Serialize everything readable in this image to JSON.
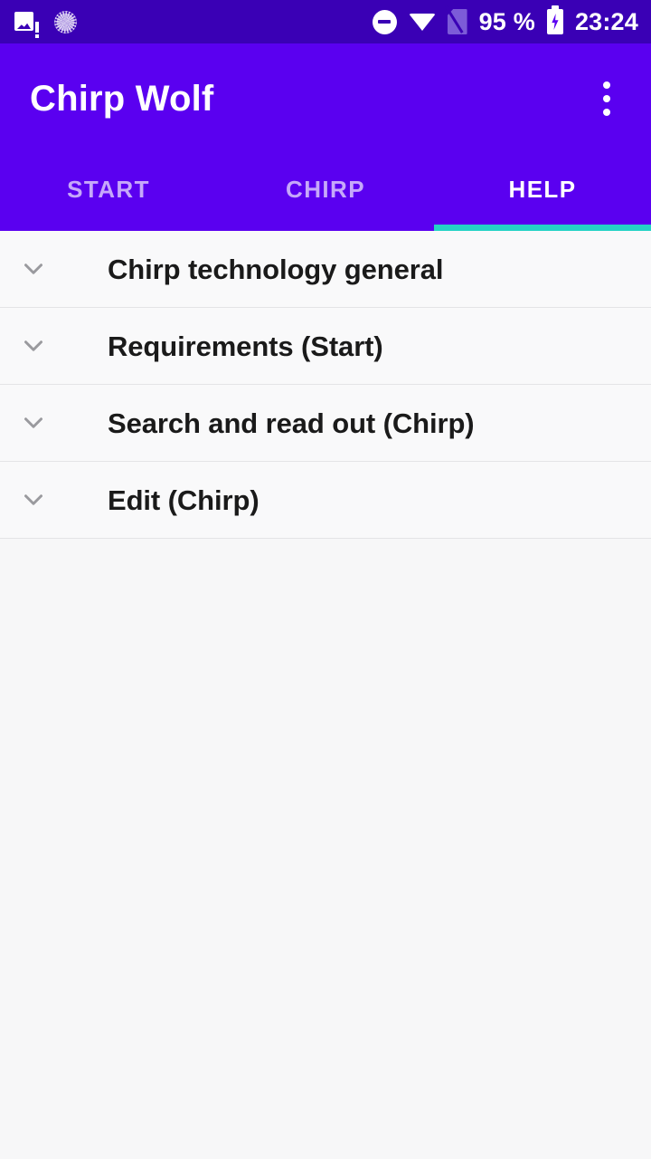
{
  "status_bar": {
    "icons_left": [
      {
        "name": "broken-image-icon",
        "label": "image notification"
      },
      {
        "name": "sync-progress-icon",
        "label": "sync in progress"
      }
    ],
    "icons_right": [
      {
        "name": "do-not-disturb-icon",
        "label": "do not disturb"
      },
      {
        "name": "wifi-icon",
        "label": "wifi connected"
      },
      {
        "name": "no-sim-icon",
        "label": "no sim card"
      }
    ],
    "battery_percent": "95 %",
    "battery_icon": "battery-charging-icon",
    "time": "23:24",
    "background_color": "#3A00B5",
    "foreground_color": "#FFFFFF"
  },
  "app_bar": {
    "title": "Chirp Wolf",
    "overflow_icon": "overflow-menu-icon",
    "background_color": "#5A00F0",
    "title_color": "#FFFFFF"
  },
  "tabs": {
    "items": [
      {
        "label": "START",
        "active": false
      },
      {
        "label": "CHIRP",
        "active": false
      },
      {
        "label": "HELP",
        "active": true
      }
    ],
    "active_index": 2,
    "indicator_color": "#24D3C5",
    "inactive_color": "rgba(255,255,255,0.66)",
    "active_color": "#FFFFFF"
  },
  "help_list": {
    "items": [
      {
        "title": "Chirp technology general",
        "expanded": false,
        "chevron": "chevron-down-icon"
      },
      {
        "title": "Requirements (Start)",
        "expanded": false,
        "chevron": "chevron-down-icon"
      },
      {
        "title": "Search and read out (Chirp)",
        "expanded": false,
        "chevron": "chevron-down-icon"
      },
      {
        "title": "Edit (Chirp)",
        "expanded": false,
        "chevron": "chevron-down-icon"
      }
    ],
    "background_color": "#F7F7F8",
    "row_color": "#F9F9FA",
    "divider_color": "#E4E4E6",
    "text_color": "#1A1A1A"
  }
}
